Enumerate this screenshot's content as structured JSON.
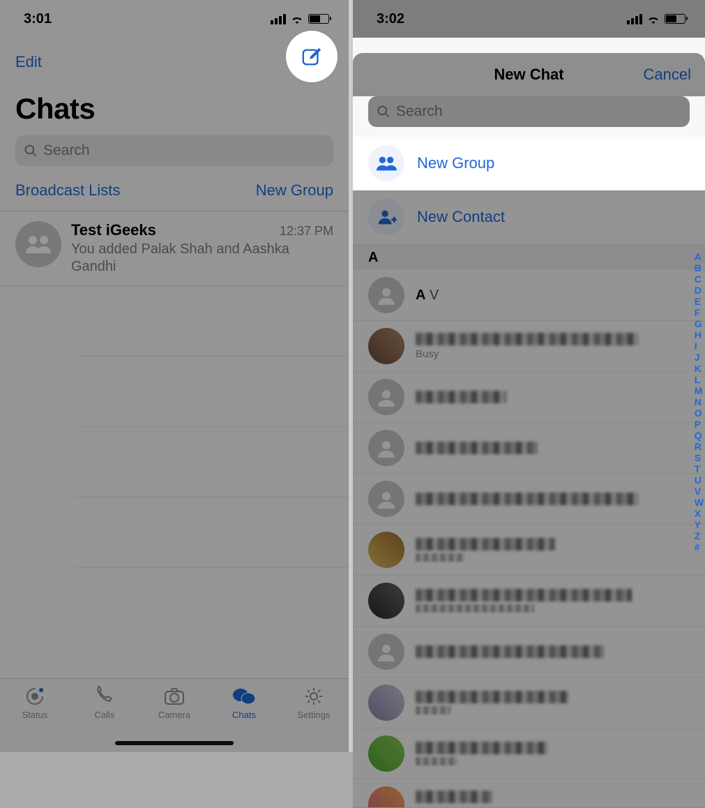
{
  "left": {
    "status": {
      "time": "3:01"
    },
    "nav": {
      "edit": "Edit"
    },
    "title": "Chats",
    "search_placeholder": "Search",
    "sublinks": {
      "broadcast": "Broadcast Lists",
      "new_group": "New Group"
    },
    "chat": {
      "name": "Test iGeeks",
      "time": "12:37 PM",
      "msg": "You added Palak Shah and Aashka Gandhi"
    },
    "tabs": {
      "status": "Status",
      "calls": "Calls",
      "camera": "Camera",
      "chats": "Chats",
      "settings": "Settings"
    }
  },
  "right": {
    "status": {
      "time": "3:02"
    },
    "modal": {
      "title": "New Chat",
      "cancel": "Cancel",
      "search_placeholder": "Search"
    },
    "options": {
      "new_group": "New Group",
      "new_contact": "New Contact"
    },
    "section": "A",
    "contacts": {
      "first_name_bold": "A",
      "first_name_rest": " V",
      "busy": "Busy"
    },
    "alpha": [
      "A",
      "B",
      "C",
      "D",
      "E",
      "F",
      "G",
      "H",
      "I",
      "J",
      "K",
      "L",
      "M",
      "N",
      "O",
      "P",
      "Q",
      "R",
      "S",
      "T",
      "U",
      "V",
      "W",
      "X",
      "Y",
      "Z",
      "#"
    ]
  }
}
